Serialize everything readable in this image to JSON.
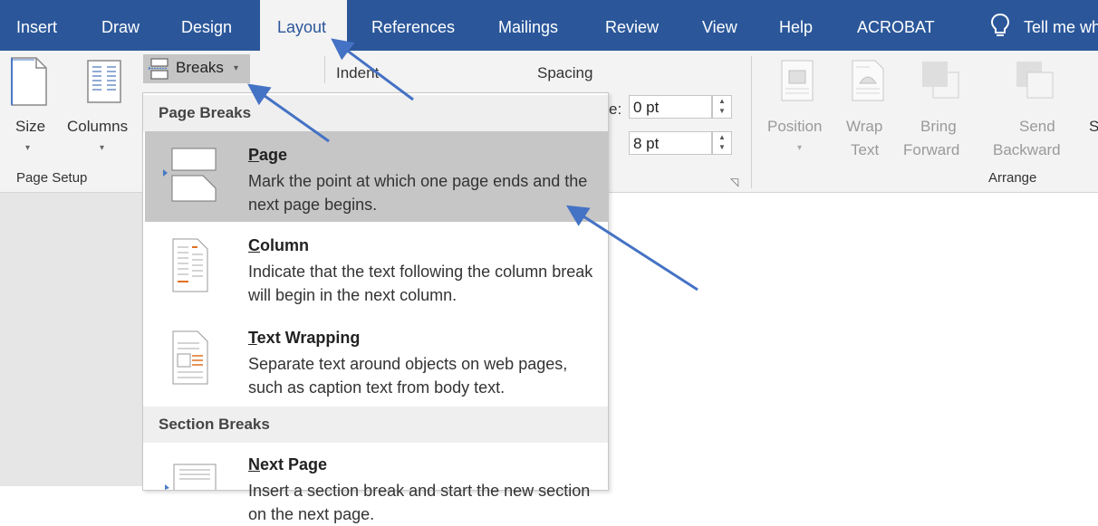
{
  "tabs": [
    {
      "label": "Insert"
    },
    {
      "label": "Draw"
    },
    {
      "label": "Design"
    },
    {
      "label": "Layout"
    },
    {
      "label": "References"
    },
    {
      "label": "Mailings"
    },
    {
      "label": "Review"
    },
    {
      "label": "View"
    },
    {
      "label": "Help"
    },
    {
      "label": "ACROBAT"
    }
  ],
  "tell_me": "Tell me wh",
  "ribbon": {
    "size_label": "Size",
    "columns_label": "Columns",
    "breaks_label": "Breaks",
    "page_setup_label": "Page Setup",
    "indent_label": "Indent",
    "spacing_label": "Spacing",
    "before_suffix": "e:",
    "spacing_before": "0 pt",
    "spacing_after": "8 pt",
    "position_label": "Position",
    "wrap_label_1": "Wrap",
    "wrap_label_2": "Text",
    "bring_label_1": "Bring",
    "bring_label_2": "Forward",
    "send_label_1": "Send",
    "send_label_2": "Backward",
    "cut_label": "S",
    "arrange_label": "Arrange"
  },
  "dropdown": {
    "page_breaks_header": "Page Breaks",
    "section_breaks_header": "Section Breaks",
    "items": [
      {
        "accel": "P",
        "rest": "age",
        "desc": "Mark the point at which one page ends and the next page begins."
      },
      {
        "accel": "C",
        "rest": "olumn",
        "desc": "Indicate that the text following the column break will begin in the next column."
      },
      {
        "accel": "T",
        "rest": "ext Wrapping",
        "desc": "Separate text around objects on web pages, such as caption text from body text."
      },
      {
        "accel": "N",
        "rest": "ext Page",
        "desc": "Insert a section break and start the new section on the next page."
      }
    ]
  },
  "colors": {
    "tabbar": "#2b579a",
    "arrow": "#4472c4",
    "highlight": "#c6c6c6"
  }
}
